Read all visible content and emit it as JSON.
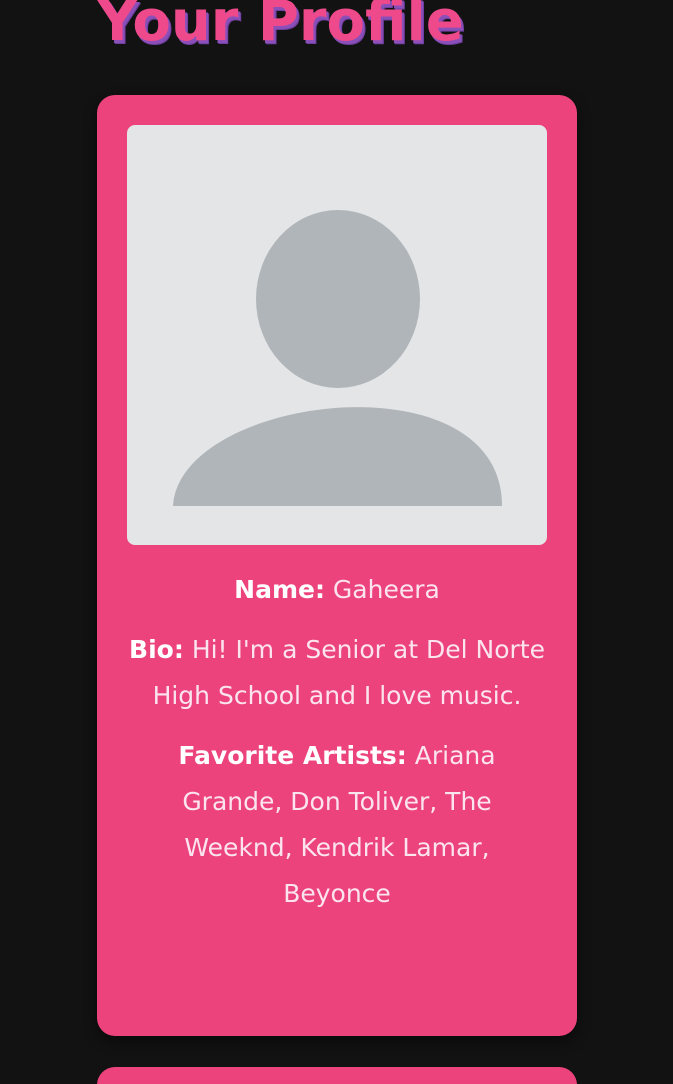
{
  "page": {
    "title": "Your Profile"
  },
  "profile": {
    "avatar_icon": "default-user-avatar-icon",
    "name_label": "Name:",
    "name_value": "Gaheera",
    "bio_label": "Bio:",
    "bio_value": "Hi! I'm a Senior at Del Norte High School and I love music.",
    "artists_label": "Favorite Artists:",
    "artists_value": "Ariana Grande, Don Toliver, The Weeknd, Kendrik Lamar, Beyonce"
  },
  "colors": {
    "background": "#121212",
    "card": "#ec437d",
    "title": "#ee4a8b",
    "title_shadow": "#8a4fb8",
    "avatar_bg": "#e4e5e7",
    "avatar_fg": "#b0b5b9",
    "text": "#fbe4ee"
  }
}
